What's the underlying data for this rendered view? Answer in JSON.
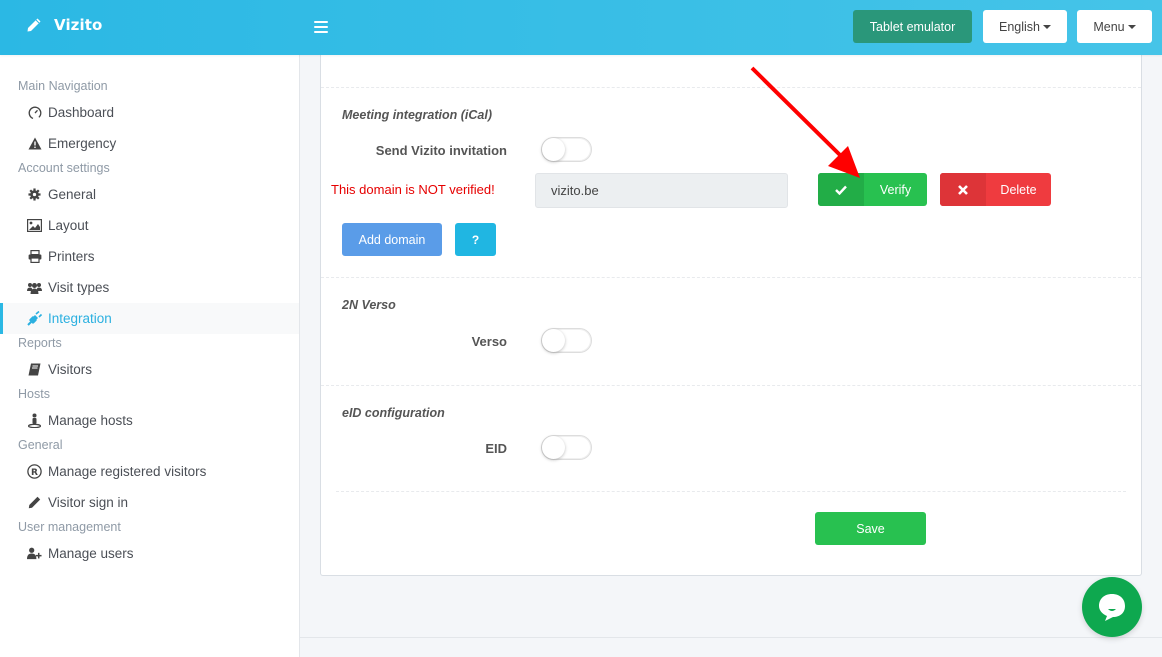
{
  "header": {
    "brand": "Vizito",
    "brand_icon": "pencil-icon",
    "menu_toggle_icon": "hamburger-icon",
    "tablet_emulator_label": "Tablet emulator",
    "language_label": "English",
    "menu_label": "Menu"
  },
  "sidebar": {
    "sections": [
      {
        "header": "Main Navigation",
        "items": [
          {
            "label": "Dashboard",
            "icon": "dashboard-gauge-icon"
          },
          {
            "label": "Emergency",
            "icon": "warning-icon"
          }
        ]
      },
      {
        "header": "Account settings",
        "items": [
          {
            "label": "General",
            "icon": "gear-icon"
          },
          {
            "label": "Layout",
            "icon": "image-icon"
          },
          {
            "label": "Printers",
            "icon": "printer-icon"
          },
          {
            "label": "Visit types",
            "icon": "users-icon"
          },
          {
            "label": "Integration",
            "icon": "plug-icon",
            "active": true
          }
        ]
      },
      {
        "header": "Reports",
        "items": [
          {
            "label": "Visitors",
            "icon": "book-icon"
          }
        ]
      },
      {
        "header": "Hosts",
        "items": [
          {
            "label": "Manage hosts",
            "icon": "host-icon"
          }
        ]
      },
      {
        "header": "General",
        "items": [
          {
            "label": "Manage registered visitors",
            "icon": "registered-icon"
          },
          {
            "label": "Visitor sign in",
            "icon": "pencil-icon"
          }
        ]
      },
      {
        "header": "User management",
        "items": [
          {
            "label": "Manage users",
            "icon": "user-plus-icon"
          }
        ]
      }
    ]
  },
  "main": {
    "ical": {
      "title": "Meeting integration (iCal)",
      "send_invitation_label": "Send Vizito invitation",
      "send_invitation_on": false,
      "domain_warning": "This domain is NOT verified!",
      "domain_value": "vizito.be",
      "verify_label": "Verify",
      "delete_label": "Delete",
      "add_domain_label": "Add domain",
      "help_label": "?"
    },
    "verso": {
      "title": "2N Verso",
      "toggle_label": "Verso",
      "on": false
    },
    "eid": {
      "title": "eID configuration",
      "toggle_label": "EID",
      "on": false
    },
    "save_label": "Save"
  },
  "colors": {
    "header": "#2bb8e4",
    "active_nav": "#2bb0e0",
    "success": "#28c150",
    "danger": "#ef3b3f",
    "primary": "#5a9ce8",
    "info": "#20b6e2",
    "warning_text": "#e60000",
    "tablet_button": "#2a977a",
    "chat": "#0ea84f"
  }
}
